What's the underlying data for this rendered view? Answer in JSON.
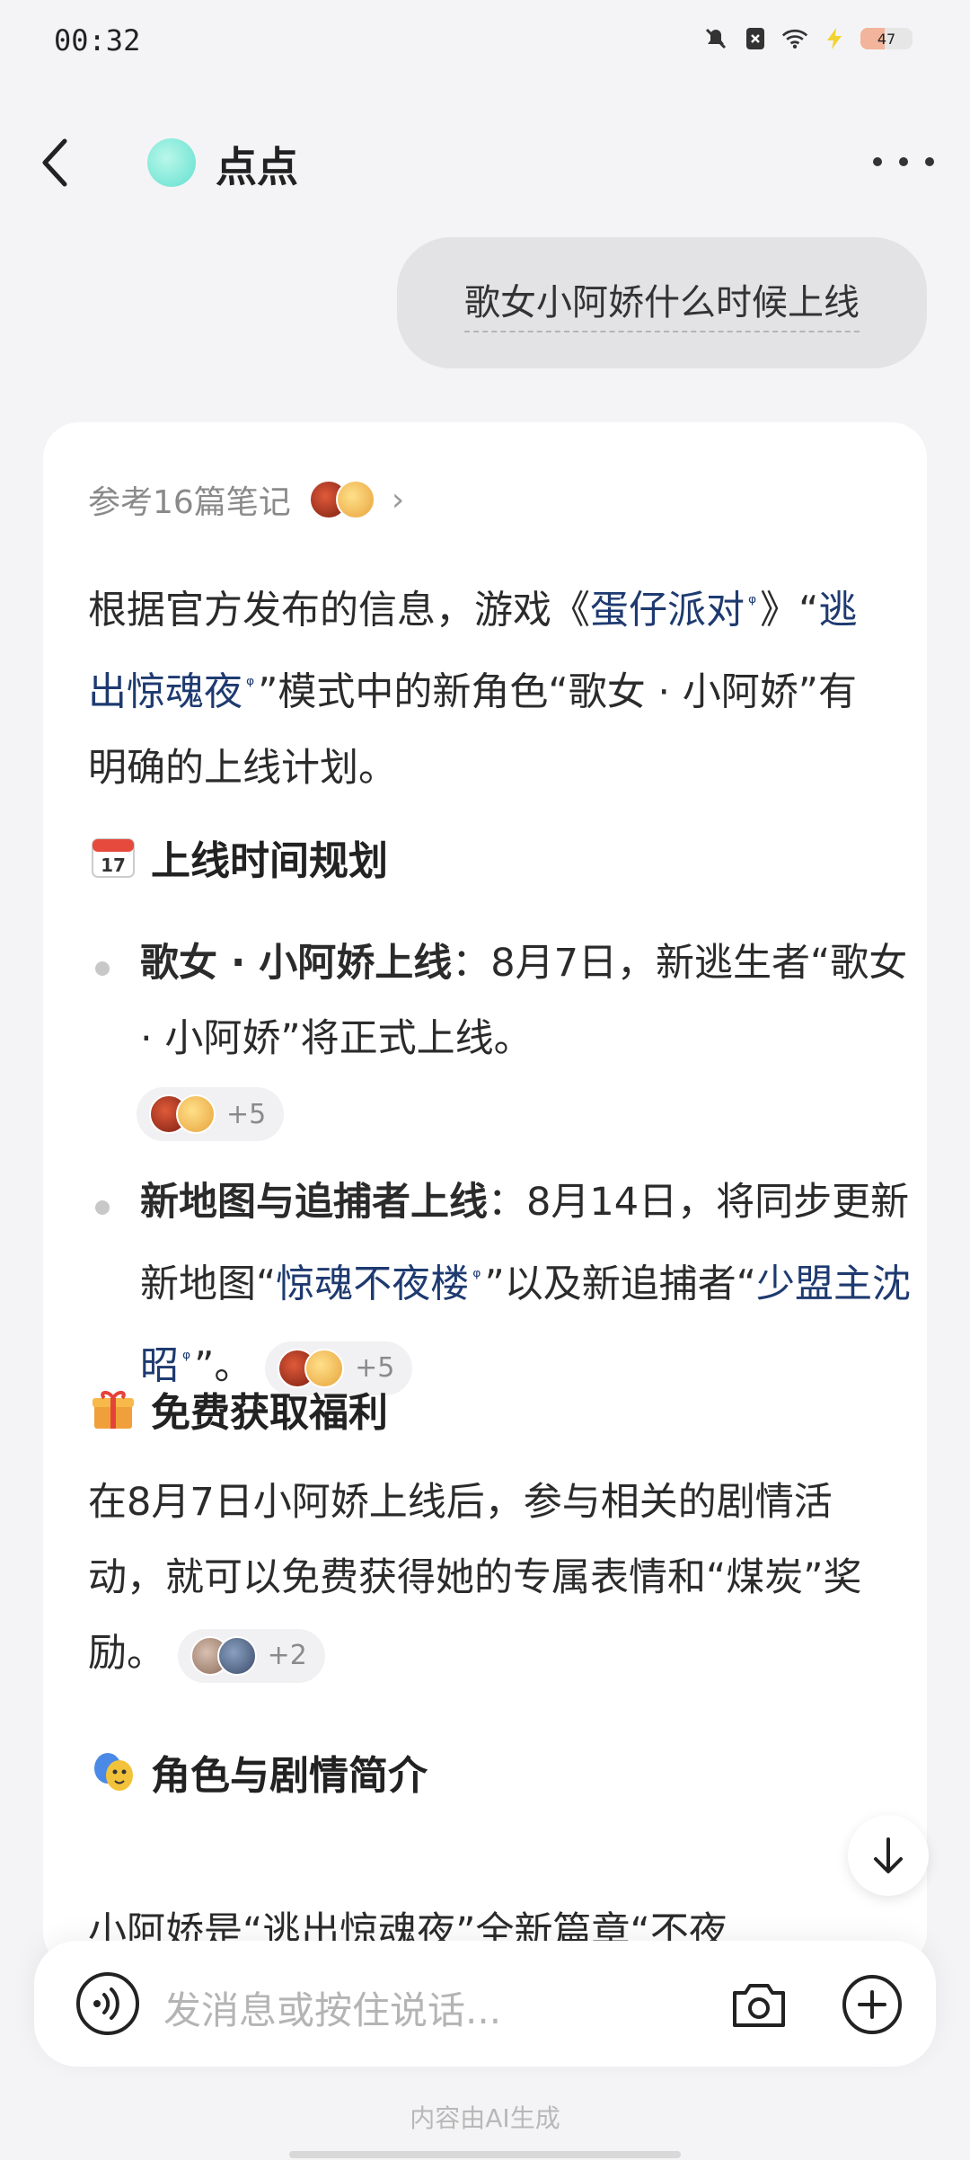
{
  "status_bar": {
    "time": "00:32",
    "battery": "47"
  },
  "header": {
    "title": "点点"
  },
  "user_message": "歌女小阿娇什么时候上线",
  "answer": {
    "refs": "参考16篇笔记",
    "intro": {
      "p1": "根据官方发布的信息，游戏《",
      "link1": "蛋仔派对",
      "p2": "》“",
      "link2": "逃出惊魂夜",
      "p3": "”模式中的新角色“歌女 · 小阿娇”有明确的上线计划。"
    },
    "section1": {
      "emoji_day": "17",
      "title": "上线时间规划",
      "bullet1": {
        "bold": "歌女 · 小阿娇上线",
        "text": "：8月7日，新逃生者“歌女 · 小阿娇”将正式上线。",
        "chip": "+5"
      },
      "bullet2": {
        "bold": "新地图与追捕者上线",
        "t1": "：8月14日，将同步更新新地图“",
        "link1": "惊魂不夜楼",
        "t2": "”以及新追捕者“",
        "link2": "少盟主沈昭",
        "t3": "”。",
        "chip": "+5"
      }
    },
    "section2": {
      "title": "免费获取福利",
      "body": "在8月7日小阿娇上线后，参与相关的剧情活动，就可以免费获得她的专属表情和“煤炭”奖励。",
      "chip": "+2"
    },
    "section3": {
      "title": "角色与剧情简介",
      "body": "小阿娇是“逃出惊魂夜”全新篇章“不夜"
    }
  },
  "input": {
    "placeholder": "发消息或按住说话..."
  },
  "footer": {
    "note": "内容由AI生成"
  },
  "icons": [
    "back-icon",
    "more-icon",
    "camera-icon",
    "plus-icon",
    "voice-icon",
    "arrow-down-icon",
    "wifi-icon",
    "mute-icon",
    "chevron-right-icon",
    "search-icon",
    "calendar-icon",
    "gift-icon",
    "theater-mask-icon"
  ],
  "colors": {
    "link": "#1e3a70",
    "background": "#f4f4f6",
    "card": "#ffffff"
  }
}
